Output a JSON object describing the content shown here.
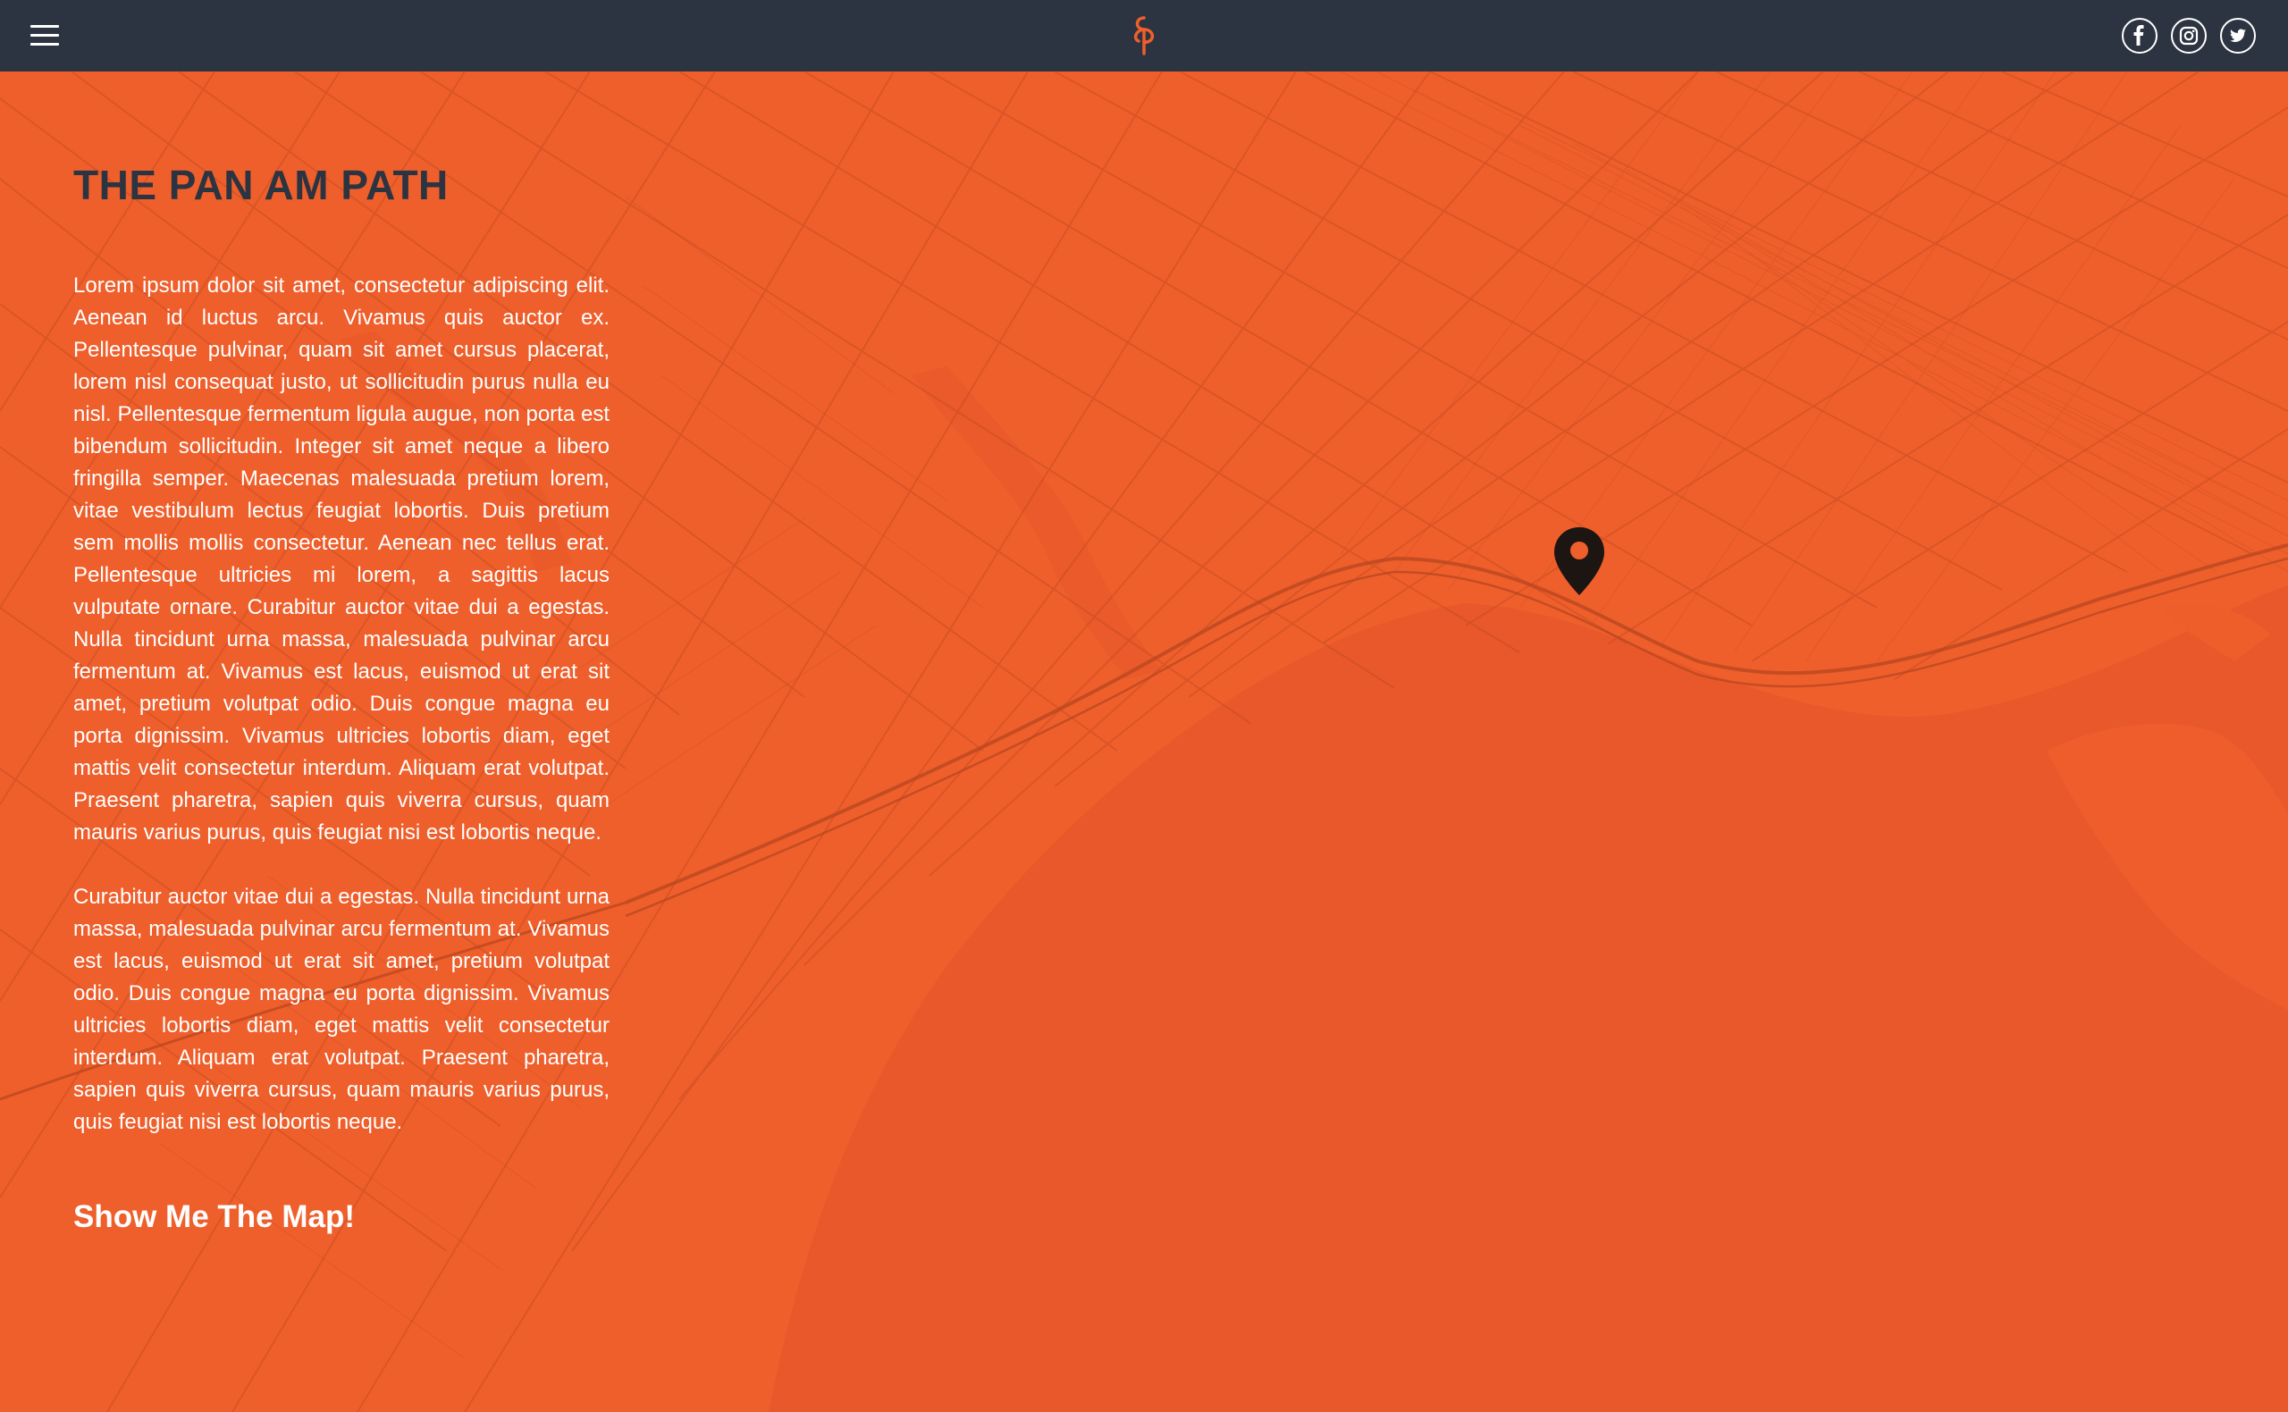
{
  "header": {
    "menu_icon": "hamburger-menu-icon",
    "logo_icon": "pan-am-path-logo-icon",
    "social": [
      {
        "name": "facebook",
        "icon": "facebook-icon"
      },
      {
        "name": "instagram",
        "icon": "instagram-icon"
      },
      {
        "name": "twitter",
        "icon": "twitter-icon"
      }
    ]
  },
  "main": {
    "title": "THE PAN AM PATH",
    "paragraph_1": "Lorem ipsum dolor sit amet, consectetur adipiscing elit. Aenean id luctus arcu. Vivamus quis auctor ex. Pellentesque pulvinar, quam sit amet cursus placerat, lorem nisl consequat justo, ut sollicitudin purus nulla eu nisl. Pellentesque fermentum ligula augue, non porta est bibendum sollicitudin. Integer sit amet neque a libero fringilla semper. Maecenas malesuada pretium lorem, vitae vestibulum lectus feugiat lobortis. Duis pretium sem mollis mollis consectetur. Aenean nec tellus erat. Pellentesque ultricies mi lorem, a sagittis lacus vulputate ornare. Curabitur auctor vitae dui a egestas. Nulla tincidunt urna massa, malesuada pulvinar arcu fermentum at. Vivamus est lacus, euismod ut erat sit amet, pretium volutpat odio. Duis congue magna eu porta dignissim. Vivamus ultricies lobortis diam, eget mattis velit consectetur interdum. Aliquam erat volutpat. Praesent pharetra, sapien quis viverra cursus, quam mauris varius purus, quis feugiat nisi est lobortis neque.",
    "paragraph_2": "Curabitur auctor vitae dui a egestas. Nulla tincidunt urna massa, malesuada pulvinar arcu fermentum at. Vivamus est lacus, euismod ut erat sit amet, pretium volutpat odio. Duis congue magna eu porta dignissim. Vivamus ultricies lobortis diam, eget mattis velit consectetur interdum. Aliquam erat volutpat. Praesent pharetra, sapien quis viverra cursus, quam mauris varius purus, quis feugiat nisi est lobortis neque.",
    "cta_label": "Show Me The Map!"
  },
  "map": {
    "pin_icon": "map-pin-icon"
  },
  "colors": {
    "header_bg": "#2c3441",
    "accent": "#ef5f2b",
    "water": "#e8582a",
    "title": "#2c3441",
    "pin": "#1c1512"
  }
}
